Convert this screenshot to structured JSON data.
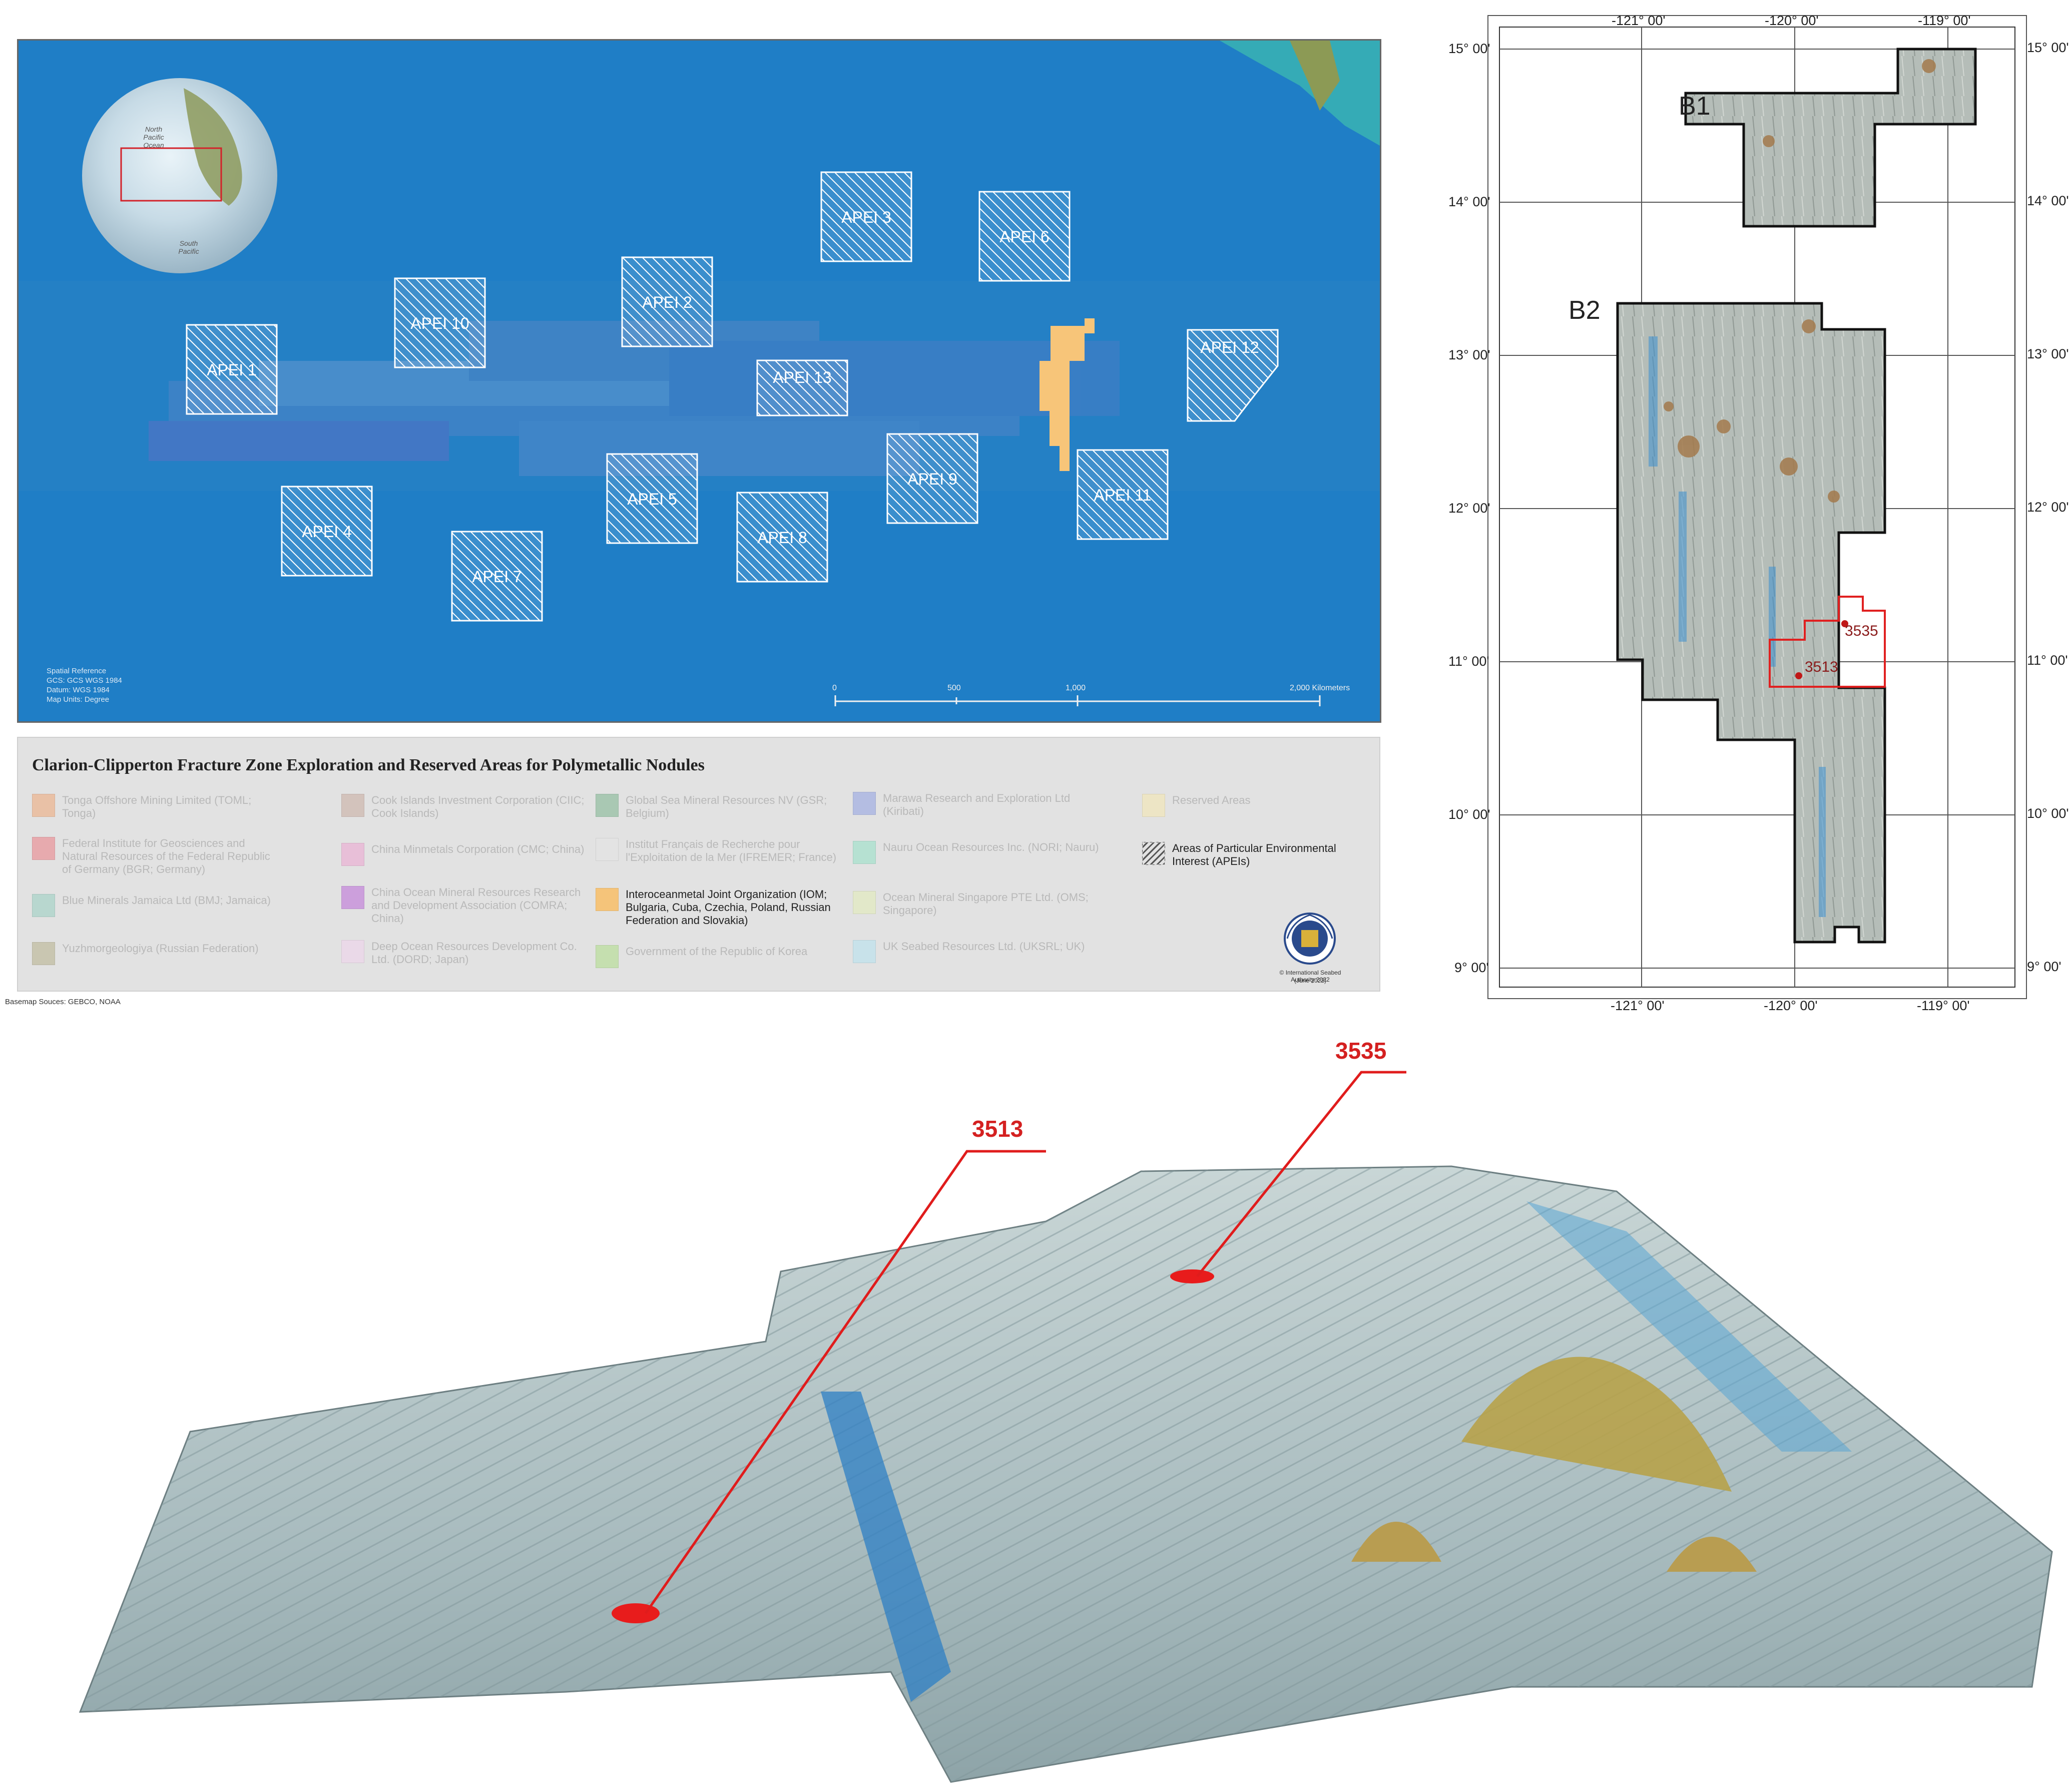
{
  "main_map": {
    "apei_labels": [
      "APEI 1",
      "APEI 2",
      "APEI 3",
      "APEI 4",
      "APEI 5",
      "APEI 6",
      "APEI 7",
      "APEI 8",
      "APEI 9",
      "APEI 10",
      "APEI 11",
      "APEI 12",
      "APEI 13"
    ],
    "spatial_reference": [
      "Spatial Reference",
      "GCS: GCS WGS 1984",
      "Datum: WGS 1984",
      "Map Units: Degree"
    ],
    "scale_labels": [
      "0",
      "500",
      "1,000",
      "2,000 Kilometers"
    ],
    "globe_labels": [
      "North",
      "Pacific",
      "Ocean",
      "South",
      "Pacific"
    ]
  },
  "legend": {
    "title": "Clarion-Clipperton Fracture Zone Exploration and Reserved Areas for Polymetallic Nodules",
    "items": [
      {
        "label": "Tonga Offshore Mining Limited (TOML; Tonga)",
        "color": "#e9c1a6",
        "active": false
      },
      {
        "label": "Federal Institute for Geosciences and Natural Resources of the Federal Republic of Germany (BGR; Germany)",
        "color": "#e7aaae",
        "active": false
      },
      {
        "label": "Blue Minerals Jamaica Ltd (BMJ; Jamaica)",
        "color": "#b8d7cf",
        "active": false
      },
      {
        "label": "Yuzhmorgeologiya (Russian Federation)",
        "color": "#c9c6b1",
        "active": false
      },
      {
        "label": "Cook Islands Investment Corporation (CIIC; Cook Islands)",
        "color": "#d3c3bc",
        "active": false
      },
      {
        "label": "China Minmetals Corporation (CMC; China)",
        "color": "#e8bfd8",
        "active": false
      },
      {
        "label": "China Ocean Mineral Resources Research and Development Association (COMRA; China)",
        "color": "#cc9fdc",
        "active": false
      },
      {
        "label": "Deep Ocean Resources Development Co. Ltd. (DORD; Japan)",
        "color": "#ead9e8",
        "active": false
      },
      {
        "label": "Global Sea Mineral Resources NV (GSR; Belgium)",
        "color": "#a9c8b3",
        "active": false
      },
      {
        "label": "Institut Français de Recherche pour l'Exploitation de la Mer (IFREMER; France)",
        "color": "#e3e3e3",
        "active": false
      },
      {
        "label": "Interoceanmetal Joint Organization (IOM; Bulgaria, Cuba, Czechia, Poland, Russian Federation and Slovakia)",
        "color": "#f5c47a",
        "active": true
      },
      {
        "label": "Government of the Republic of Korea",
        "color": "#c5dfaf",
        "active": false
      },
      {
        "label": "Marawa Research and Exploration Ltd (Kiribati)",
        "color": "#b4bde2",
        "active": false
      },
      {
        "label": "Nauru Ocean Resources Inc. (NORI; Nauru)",
        "color": "#b6e1d2",
        "active": false
      },
      {
        "label": "Ocean Mineral Singapore PTE Ltd. (OMS; Singapore)",
        "color": "#e2e8c9",
        "active": false
      },
      {
        "label": "UK Seabed Resources Ltd. (UKSRL; UK)",
        "color": "#c8e2ea",
        "active": false
      },
      {
        "label": "Reserved Areas",
        "color": "#ede5c5",
        "active": false
      },
      {
        "label": "Areas of Particular Environmental Interest (APEIs)",
        "color": "hatch",
        "active": true
      }
    ],
    "copyright": [
      "© International Seabed Authority 2022",
      "(June 2022)"
    ],
    "basemap_source": "Basemap Souces: GEBCO, NOAA"
  },
  "right_map": {
    "top_ticks": [
      "-121° 00'",
      "-120° 00'",
      "-119° 00'"
    ],
    "bottom_ticks": [
      "-121° 00'",
      "-120° 00'",
      "-119° 00'"
    ],
    "left_ticks": [
      "15° 00'",
      "14° 00'",
      "13° 00'",
      "12° 00'",
      "11° 00'",
      "10° 00'",
      "9° 00'"
    ],
    "right_ticks": [
      "15° 00'",
      "14° 00'",
      "13° 00'",
      "12° 00'",
      "11° 00'",
      "10° 00'",
      "9° 00'"
    ],
    "block_labels": [
      "B1",
      "B2"
    ],
    "station_labels": [
      "3535",
      "3513"
    ]
  },
  "terrain": {
    "station_labels": [
      "3535",
      "3513"
    ]
  }
}
